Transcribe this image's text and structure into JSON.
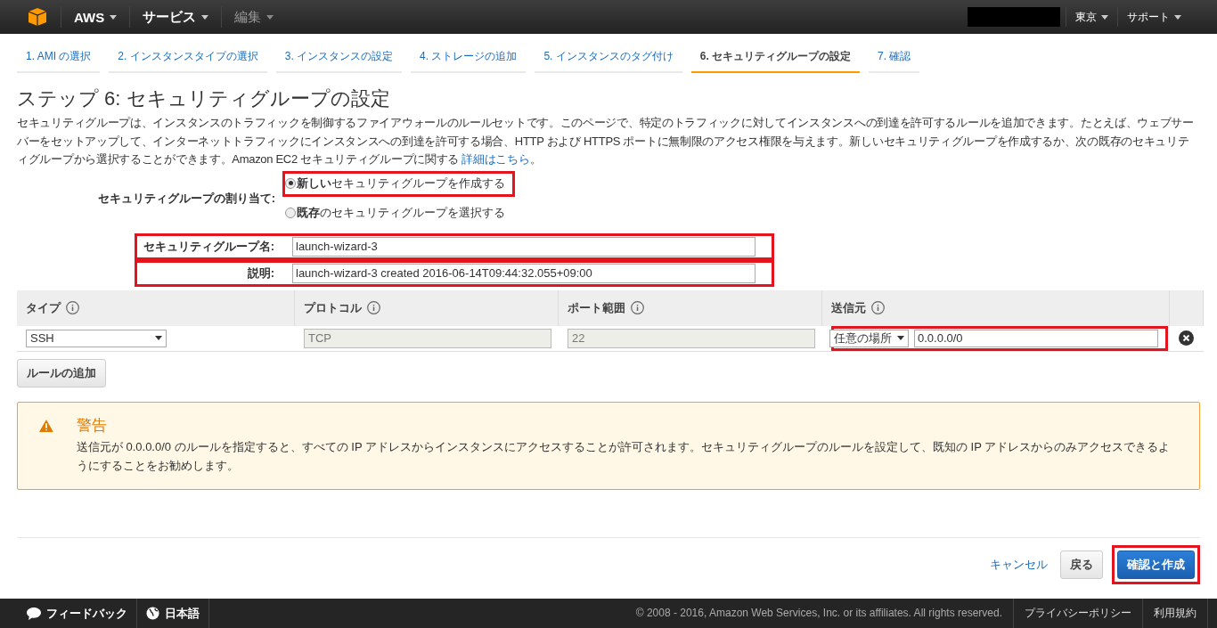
{
  "top_nav": {
    "items": [
      {
        "label": "AWS",
        "disabled": false
      },
      {
        "label": "サービス",
        "disabled": false
      },
      {
        "label": "編集",
        "disabled": true
      }
    ],
    "right_items": [
      "東京",
      "サポート"
    ]
  },
  "wizard_tabs": [
    {
      "label": "1. AMI の選択",
      "selected": false
    },
    {
      "label": "2. インスタンスタイプの選択",
      "selected": false
    },
    {
      "label": "3. インスタンスの設定",
      "selected": false
    },
    {
      "label": "4. ストレージの追加",
      "selected": false
    },
    {
      "label": "5. インスタンスのタグ付け",
      "selected": false
    },
    {
      "label": "6. セキュリティグループの設定",
      "selected": true
    },
    {
      "label": "7. 確認",
      "selected": false
    }
  ],
  "page_title": "ステップ 6: セキュリティグループの設定",
  "intro": {
    "text": "セキュリティグループは、インスタンスのトラフィックを制御するファイアウォールのルールセットです。このページで、特定のトラフィックに対してインスタンスへの到達を許可するルールを追加できます。たとえば、ウェブサーバーをセットアップして、インターネットトラフィックにインスタンスへの到達を許可する場合、HTTP および HTTPS ポートに無制限のアクセス権限を与えます。新しいセキュリティグループを作成するか、次の既存のセキュリティグループから選択することができます。Amazon EC2 セキュリティグループに関する ",
    "link": "詳細はこちら",
    "end": "。"
  },
  "assign": {
    "label": "セキュリティグループの割り当て:",
    "options": [
      {
        "label": "**新しい**セキュリティグループを作成する",
        "selected": true,
        "highlighted": true
      },
      {
        "label": "**既存**のセキュリティグループを選択する",
        "selected": false,
        "highlighted": false
      }
    ]
  },
  "fields": [
    {
      "label": "セキュリティグループ名:",
      "value": "launch-wizard-3",
      "highlighted": true
    },
    {
      "label": "説明:",
      "value": "launch-wizard-3 created 2016-06-14T09:44:32.055+09:00",
      "highlighted": true
    }
  ],
  "rules_table": {
    "columns": [
      "タイプ",
      "プロトコル",
      "ポート範囲",
      "送信元"
    ],
    "rows": [
      {
        "type": "SSH",
        "protocol": "TCP",
        "port_range": "22",
        "source_select": "任意の場所",
        "source_value": "0.0.0.0/0",
        "highlighted": true
      }
    ]
  },
  "add_rule_button": "ルールの追加",
  "warning": {
    "title": "警告",
    "text": "送信元が 0.0.0.0/0 のルールを指定すると、すべての IP アドレスからインスタンスにアクセスすることが許可されます。セキュリティグループのルールを設定して、既知の IP アドレスからのみアクセスできるようにすることをお勧めします。"
  },
  "actions": {
    "cancel": "キャンセル",
    "back": "戻る",
    "confirm": "確認と作成",
    "confirm_highlighted": true
  },
  "footer": {
    "feedback": "フィードバック",
    "language": "日本語",
    "copyright": "© 2008 - 2016, Amazon Web Services, Inc. or its affiliates. All rights reserved.",
    "links": [
      "プライバシーポリシー",
      "利用規約"
    ]
  }
}
